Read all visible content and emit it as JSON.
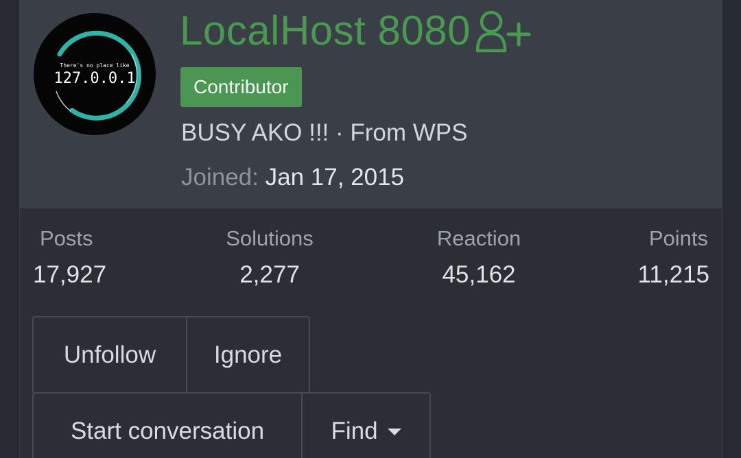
{
  "profile": {
    "avatar_icon": "localhost-127-avatar-icon",
    "avatar_small_text": "There's no place like",
    "avatar_big_text": "127.0.0.1",
    "username": "LocalHost 8080",
    "follow_icon": "add-user-icon",
    "badge": "Contributor",
    "tagline": "BUSY AKO !!! · From WPS",
    "joined_label": "Joined:",
    "joined_value": "Jan 17, 2015"
  },
  "stats": [
    {
      "label": "Posts",
      "value": "17,927"
    },
    {
      "label": "Solutions",
      "value": "2,277"
    },
    {
      "label": "Reaction",
      "value": "45,162"
    },
    {
      "label": "Points",
      "value": "11,215"
    }
  ],
  "buttons": {
    "unfollow": "Unfollow",
    "ignore": "Ignore",
    "start_conversation": "Start conversation",
    "find": "Find",
    "find_icon": "caret-down-icon"
  },
  "colors": {
    "accent_green": "#4a9950",
    "badge_green": "#4c9653",
    "avatar_ring": "#2fb2a8",
    "header_bg": "#393e47",
    "body_bg": "#2b2e35"
  }
}
